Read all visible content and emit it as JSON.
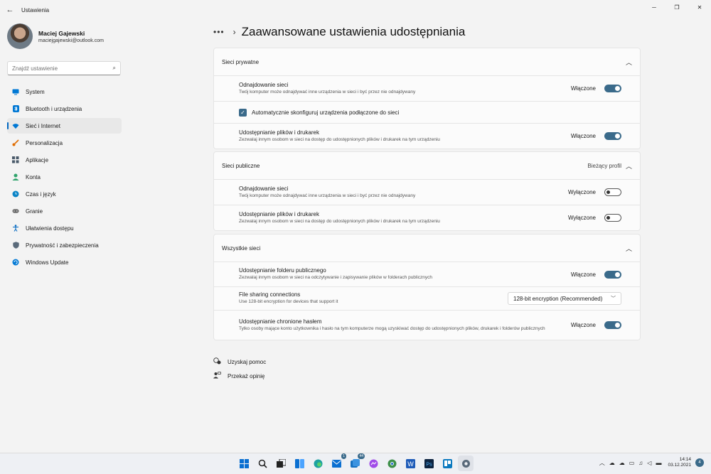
{
  "window": {
    "back_glyph": "←",
    "title": "Ustawienia",
    "minimize_glyph": "─",
    "maximize_glyph": "❐",
    "close_glyph": "✕"
  },
  "profile": {
    "name": "Maciej Gajewski",
    "email": "maciejgajewski@outlook.com"
  },
  "search": {
    "placeholder": "Znajdź ustawienie"
  },
  "nav": [
    {
      "label": "System",
      "icon": "monitor-icon",
      "color": "#0078d4"
    },
    {
      "label": "Bluetooth i urządzenia",
      "icon": "bluetooth-icon",
      "color": "#0078d4"
    },
    {
      "label": "Sieć i Internet",
      "icon": "wifi-icon",
      "color": "#0078d4",
      "active": true
    },
    {
      "label": "Personalizacja",
      "icon": "brush-icon",
      "color": "#e06c00"
    },
    {
      "label": "Aplikacje",
      "icon": "apps-icon",
      "color": "#4a5a6a"
    },
    {
      "label": "Konta",
      "icon": "person-icon",
      "color": "#2fa36b"
    },
    {
      "label": "Czas i język",
      "icon": "globe-clock-icon",
      "color": "#0a84c6"
    },
    {
      "label": "Granie",
      "icon": "gamepad-icon",
      "color": "#6a6a6a"
    },
    {
      "label": "Ułatwienia dostępu",
      "icon": "accessibility-icon",
      "color": "#0067c0"
    },
    {
      "label": "Prywatność i zabezpieczenia",
      "icon": "shield-icon",
      "color": "#5a6a7a"
    },
    {
      "label": "Windows Update",
      "icon": "update-icon",
      "color": "#0078d4"
    }
  ],
  "header": {
    "dots": "•••",
    "separator": "›",
    "title": "Zaawansowane ustawienia udostępniania"
  },
  "private": {
    "title": "Sieci prywatne",
    "discovery": {
      "title": "Odnajdowanie sieci",
      "desc": "Twój komputer może odnajdywać inne urządzenia w sieci i być przez nie odnajdywany",
      "state": "Włączone"
    },
    "autoconfig": {
      "label": "Automatycznie skonfiguruj urządzenia podłączone do sieci",
      "checked": true
    },
    "sharing": {
      "title": "Udostępnianie plików i drukarek",
      "desc": "Zezwalaj innym osobom w sieci na dostęp do udostępnionych plików i drukarek na tym urządzeniu",
      "state": "Włączone"
    }
  },
  "public": {
    "title": "Sieci publiczne",
    "badge": "Bieżący profil",
    "discovery": {
      "title": "Odnajdowanie sieci",
      "desc": "Twój komputer może odnajdywać inne urządzenia w sieci i być przez nie odnajdywany",
      "state": "Wyłączone"
    },
    "sharing": {
      "title": "Udostępnianie plików i drukarek",
      "desc": "Zezwalaj innym osobom w sieci na dostęp do udostępnionych plików i drukarek na tym urządzeniu",
      "state": "Wyłączone"
    }
  },
  "all": {
    "title": "Wszystkie sieci",
    "public_folder": {
      "title": "Udostępnianie folderu publicznego",
      "desc": "Zezwalaj innym osobom w sieci na odczytywanie i zapisywanie plików w folderach publicznych",
      "state": "Włączone"
    },
    "file_sharing": {
      "title": "File sharing connections",
      "desc": "Use 128-bit encryption for devices that support it",
      "selected": "128-bit encryption (Recommended)"
    },
    "password": {
      "title": "Udostępnianie chronione hasłem",
      "desc": "Tylko osoby mające konto użytkownika i hasło na tym komputerze mogą uzyskiwać dostęp do udostępnionych plików, drukarek i folderów publicznych",
      "state": "Włączone"
    }
  },
  "links": {
    "help": "Uzyskaj pomoc",
    "feedback": "Przekaż opinię"
  },
  "taskbar": {
    "mail_badge": "1",
    "teams_badge": "44",
    "ps_label": "Ps",
    "word_label": "W",
    "clock_time": "14:14",
    "clock_date": "03.12.2021",
    "notifications": "4"
  },
  "colors": {
    "accent": "#3a6a8a",
    "nav_indicator": "#0067c0"
  }
}
